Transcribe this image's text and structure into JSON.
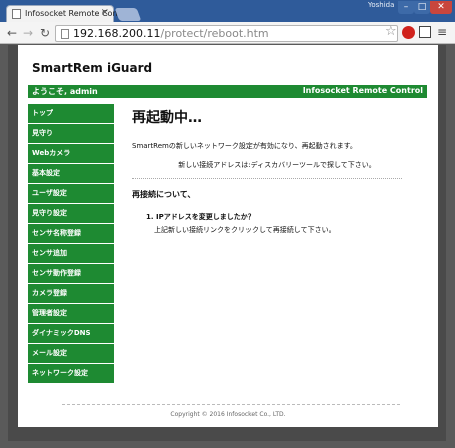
{
  "browser": {
    "tab_title": "Infosocket Remote Con",
    "user_label": "Yoshida",
    "url_host": "192.168.200.11",
    "url_path": "/protect/reboot.htm"
  },
  "page": {
    "brand": "SmartRem iGuard",
    "welcome": "ようこそ, admin",
    "welcome_brand": "Infosocket Remote Control",
    "sidebar": [
      {
        "label": "トップ"
      },
      {
        "label": "見守り"
      },
      {
        "label": "Webカメラ"
      },
      {
        "label": "基本設定"
      },
      {
        "label": "ユーザ設定"
      },
      {
        "label": "見守り設定"
      },
      {
        "label": "センサ名称登録"
      },
      {
        "label": "センサ追加"
      },
      {
        "label": "センサ動作登録"
      },
      {
        "label": "カメラ登録"
      },
      {
        "label": "管理者設定"
      },
      {
        "label": "ダイナミックDNS"
      },
      {
        "label": "メール設定"
      },
      {
        "label": "ネットワーク設定"
      }
    ],
    "heading": "再起動中…",
    "message1": "SmartRemの新しいネットワーク設定が有効になり、再起動されます。",
    "message2": "新しい接続アドレスは:ディスカバリーツールで探して下さい。",
    "subheading": "再接続について、",
    "faq_question": "1. IPアドレスを変更しましたか？",
    "faq_answer": "上記新しい接続リンクをクリックして再接続して下さい。",
    "footer": "Copyright © 2016 Infosocket Co., LTD."
  },
  "colors": {
    "brand_green": "#1e8a32",
    "browser_frame": "#2f5b9a"
  }
}
